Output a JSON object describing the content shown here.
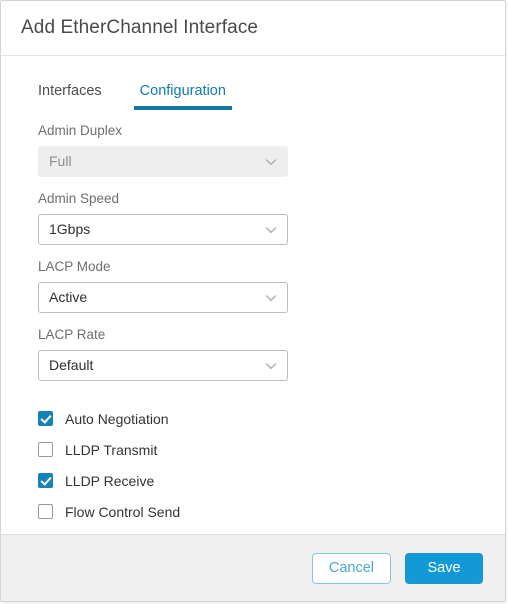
{
  "dialog": {
    "title": "Add EtherChannel Interface"
  },
  "tabs": [
    {
      "label": "Interfaces",
      "active": false
    },
    {
      "label": "Configuration",
      "active": true
    }
  ],
  "form": {
    "fields": [
      {
        "label": "Admin Duplex",
        "value": "Full",
        "disabled": true,
        "icon": "chevron-down-icon",
        "name": "admin-duplex"
      },
      {
        "label": "Admin Speed",
        "value": "1Gbps",
        "disabled": false,
        "icon": "chevron-down-icon",
        "name": "admin-speed"
      },
      {
        "label": "LACP Mode",
        "value": "Active",
        "disabled": false,
        "icon": "chevron-down-icon",
        "name": "lacp-mode"
      },
      {
        "label": "LACP Rate",
        "value": "Default",
        "disabled": false,
        "icon": "chevron-down-icon",
        "name": "lacp-rate"
      }
    ],
    "checkboxes": [
      {
        "label": "Auto Negotiation",
        "checked": true,
        "name": "auto-negotiation"
      },
      {
        "label": "LLDP Transmit",
        "checked": false,
        "name": "lldp-transmit"
      },
      {
        "label": "LLDP Receive",
        "checked": true,
        "name": "lldp-receive"
      },
      {
        "label": "Flow Control Send",
        "checked": false,
        "name": "flow-control-send"
      }
    ]
  },
  "footer": {
    "cancel_label": "Cancel",
    "save_label": "Save"
  },
  "colors": {
    "accent_tab": "#1278a0",
    "accent_save": "#139ad6",
    "accent_checkbox": "#1483b8",
    "cancel_text": "#48a8db",
    "cancel_border": "#7ec8e8",
    "footer_bg": "#f0f0f0"
  }
}
